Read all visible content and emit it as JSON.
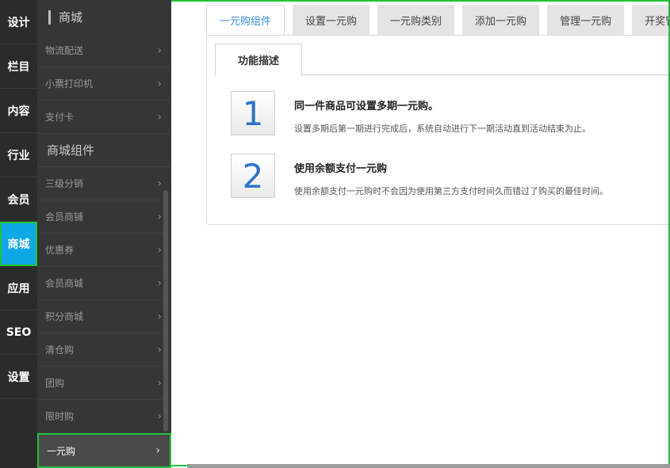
{
  "left_nav": {
    "items": [
      {
        "label": "设计"
      },
      {
        "label": "栏目"
      },
      {
        "label": "内容"
      },
      {
        "label": "行业"
      },
      {
        "label": "会员"
      },
      {
        "label": "商城"
      },
      {
        "label": "应用"
      },
      {
        "label": "SEO"
      },
      {
        "label": "设置"
      }
    ],
    "active": "商城"
  },
  "sub_nav": {
    "title": "商城",
    "items_top": [
      {
        "label": "物流配送"
      },
      {
        "label": "小票打印机"
      },
      {
        "label": "支付卡"
      }
    ],
    "section_title": "商城组件",
    "items_section": [
      {
        "label": "三级分销"
      },
      {
        "label": "会员商铺"
      },
      {
        "label": "优惠券"
      },
      {
        "label": "会员商城"
      },
      {
        "label": "积分商城"
      },
      {
        "label": "清仓购"
      },
      {
        "label": "团购"
      },
      {
        "label": "限时购"
      }
    ],
    "active_item": {
      "label": "一元购"
    },
    "chevron": "›"
  },
  "tabs": [
    {
      "label": "一元购组件",
      "active": true
    },
    {
      "label": "设置一元购"
    },
    {
      "label": "一元购类别"
    },
    {
      "label": "添加一元购"
    },
    {
      "label": "管理一元购"
    },
    {
      "label": "开奖管理"
    }
  ],
  "subtab": {
    "label": "功能描述"
  },
  "features": [
    {
      "number": "1",
      "title": "同一件商品可设置多期一元购。",
      "desc": "设置多期后第一期进行完成后，系统自动进行下一期活动直到活动结束为止。"
    },
    {
      "number": "2",
      "title": "使用余额支付一元购",
      "desc": "使用余额支付一元购时不会因为使用第三方支付时间久而错过了购买的最佳时间。"
    }
  ],
  "colors": {
    "accent": "#0ea8e6",
    "highlight_border": "#22c23a",
    "tab_active_text": "#3a8fd9"
  }
}
